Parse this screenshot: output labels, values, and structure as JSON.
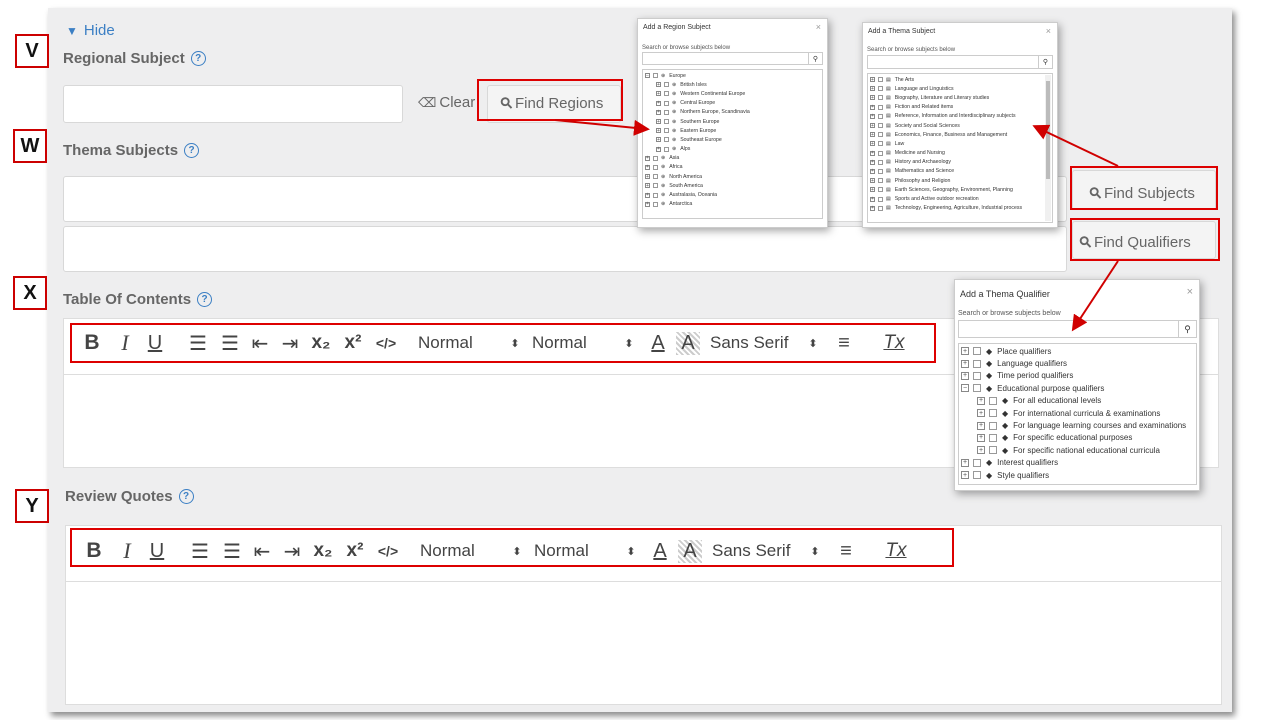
{
  "letters": {
    "v": "V",
    "w": "W",
    "x": "X",
    "y": "Y"
  },
  "hide": {
    "arrow": "▼",
    "label": "Hide"
  },
  "regional": {
    "label": "Regional Subject",
    "clear_icon": "eraser-icon",
    "clear_label": "Clear",
    "find_label": "Find Regions"
  },
  "thema": {
    "label": "Thema Subjects",
    "find_subjects_label": "Find Subjects",
    "find_qualifiers_label": "Find Qualifiers"
  },
  "toc": {
    "label": "Table Of Contents"
  },
  "review": {
    "label": "Review Quotes"
  },
  "help_icon_glyph": "?",
  "search_icon_glyph": "⚲",
  "toolbar": {
    "bold": "B",
    "italic": "I",
    "underline": "U",
    "ordered_list": "☰",
    "bullet_list": "☰",
    "outdent": "⇤",
    "indent": "⇥",
    "subscript": "x₂",
    "superscript": "x²",
    "code": "</>",
    "header_select": "Normal",
    "size_select": "Normal",
    "color": "A",
    "background": "A",
    "font_select": "Sans Serif",
    "align": "≡",
    "clean": "Tx",
    "select_arrows": "⬍"
  },
  "region_modal": {
    "title": "Add a Region Subject",
    "close": "×",
    "hint": "Search or browse subjects below",
    "items": [
      {
        "label": "Europe",
        "level": 0,
        "expanded": true
      },
      {
        "label": "British Isles",
        "level": 1
      },
      {
        "label": "Western Continental Europe",
        "level": 1
      },
      {
        "label": "Central Europe",
        "level": 1
      },
      {
        "label": "Northern Europe, Scandinavia",
        "level": 1
      },
      {
        "label": "Southern Europe",
        "level": 1
      },
      {
        "label": "Eastern Europe",
        "level": 1
      },
      {
        "label": "Southeast Europe",
        "level": 1
      },
      {
        "label": "Alps",
        "level": 1
      },
      {
        "label": "Asia",
        "level": 0
      },
      {
        "label": "Africa",
        "level": 0
      },
      {
        "label": "North America",
        "level": 0
      },
      {
        "label": "South America",
        "level": 0
      },
      {
        "label": "Australasia, Oceania",
        "level": 0
      },
      {
        "label": "Antarctica",
        "level": 0
      }
    ]
  },
  "thema_modal": {
    "title": "Add a Thema Subject",
    "close": "×",
    "hint": "Search or browse subjects below",
    "items": [
      "The Arts",
      "Language and Linguistics",
      "Biography, Literature and Literary studies",
      "Fiction and Related items",
      "Reference, Information and Interdisciplinary subjects",
      "Society and Social Sciences",
      "Economics, Finance, Business and Management",
      "Law",
      "Medicine and Nursing",
      "History and Archaeology",
      "Mathematics and Science",
      "Philosophy and Religion",
      "Earth Sciences, Geography, Environment, Planning",
      "Sports and Active outdoor recreation",
      "Technology, Engineering, Agriculture, Industrial process"
    ]
  },
  "qualifier_modal": {
    "title": "Add a Thema Qualifier",
    "close": "×",
    "hint": "Search or browse subjects below",
    "items": [
      {
        "label": "Place qualifiers",
        "level": 0
      },
      {
        "label": "Language qualifiers",
        "level": 0
      },
      {
        "label": "Time period qualifiers",
        "level": 0
      },
      {
        "label": "Educational purpose qualifiers",
        "level": 0,
        "expanded": true
      },
      {
        "label": "For all educational levels",
        "level": 1
      },
      {
        "label": "For international curricula & examinations",
        "level": 1
      },
      {
        "label": "For language learning courses and examinations",
        "level": 1
      },
      {
        "label": "For specific educational purposes",
        "level": 1
      },
      {
        "label": "For specific national educational curricula",
        "level": 1
      },
      {
        "label": "Interest qualifiers",
        "level": 0
      },
      {
        "label": "Style qualifiers",
        "level": 0
      }
    ]
  },
  "colors": {
    "accent": "#3b7fc4",
    "annotation_red": "#d00000",
    "panel_bg": "#eeeeef"
  }
}
